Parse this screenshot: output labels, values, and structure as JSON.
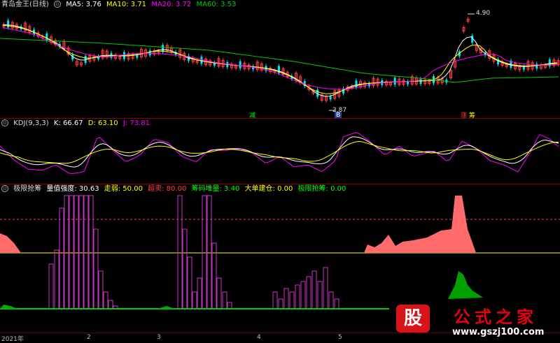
{
  "main_legend": {
    "title": "青岛金王(日线)",
    "ma5": "MA5: 3.76",
    "ma10": "MA10: 3.71",
    "ma20": "MA20: 3.72",
    "ma60": "MA60: 3.53",
    "colors": {
      "ma5": "#ffffff",
      "ma10": "#ffff00",
      "ma20": "#ff00ff",
      "ma60": "#00cc00"
    }
  },
  "main_chart": {
    "high_label": "4.90",
    "low_label": "2.87",
    "tag_jian": "减",
    "tag_zhang": "涨",
    "tag_chou": "筹",
    "tag_b": "B"
  },
  "kdj_legend": {
    "title": "KDJ(9,3,3)",
    "k": "K: 66.67",
    "d": "D: 63.10",
    "j": "J: 73.81",
    "colors": {
      "k": "#ffffff",
      "d": "#ffff00",
      "j": "#ff00ff"
    }
  },
  "signal_legend": {
    "title": "极限抢筹",
    "strength": "量值强度: 30.63",
    "weak": "走弱: 50.00",
    "overbought": "超卖: 80.00",
    "accumulate": "筹码堆量: 3.40",
    "bigorder": "大单建仓: 0.00",
    "grab": "极限抢筹: 0.00",
    "colors": {
      "strength": "#ffffff",
      "weak": "#ffff00",
      "overbought": "#ff4040",
      "accumulate": "#00ff00",
      "bigorder": "#ffff00",
      "grab": "#00ff00"
    }
  },
  "x_axis": {
    "labels": [
      "2021年",
      "2",
      "3",
      "4",
      "5"
    ]
  },
  "watermark": {
    "logo_char": "股",
    "site_name": "公式之家",
    "url": "www.gszj100.com"
  }
}
